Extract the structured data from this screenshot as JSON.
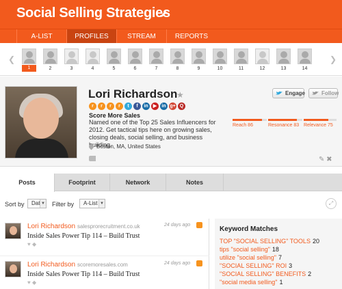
{
  "header": {
    "title": "Social Selling Strategies",
    "edit_icon": "pencil-icon"
  },
  "nav": {
    "tabs": [
      {
        "label": "A-LIST"
      },
      {
        "label": "PROFILES"
      },
      {
        "label": "STREAM"
      },
      {
        "label": "REPORTS"
      }
    ],
    "active": "PROFILES"
  },
  "strip": {
    "prev_icon": "chevron-left-icon",
    "next_icon": "chevron-right-icon",
    "active_index": 1,
    "thumbs": [
      {
        "num": "1",
        "has_photo": true
      },
      {
        "num": "2",
        "has_photo": true
      },
      {
        "num": "3",
        "has_photo": false
      },
      {
        "num": "4",
        "has_photo": false
      },
      {
        "num": "5",
        "has_photo": true
      },
      {
        "num": "6",
        "has_photo": true
      },
      {
        "num": "7",
        "has_photo": true
      },
      {
        "num": "8",
        "has_photo": true
      },
      {
        "num": "9",
        "has_photo": true
      },
      {
        "num": "10",
        "has_photo": true
      },
      {
        "num": "11",
        "has_photo": true
      },
      {
        "num": "12",
        "has_photo": false
      },
      {
        "num": "13",
        "has_photo": true
      },
      {
        "num": "14",
        "has_photo": true
      }
    ]
  },
  "profile": {
    "name": "Lori Richardson",
    "headline": "Score More Sales",
    "bio": "Named one of the Top 25 Sales Influencers for 2012. Get tactical tips here on growing sales, closing deals, social selling, and business building.",
    "location": "Boston, MA, United States",
    "engage_label": "Engage",
    "follow_label": "Follow",
    "social_icons": [
      {
        "name": "rss-icon",
        "glyph": "r",
        "color": "#f7931e"
      },
      {
        "name": "rss-icon",
        "glyph": "r",
        "color": "#f7931e"
      },
      {
        "name": "rss-icon",
        "glyph": "r",
        "color": "#f7931e"
      },
      {
        "name": "rss-icon",
        "glyph": "r",
        "color": "#f7931e"
      },
      {
        "name": "twitter-icon",
        "glyph": "t",
        "color": "#33aadd"
      },
      {
        "name": "facebook-icon",
        "glyph": "f",
        "color": "#3b5998"
      },
      {
        "name": "linkedin-icon",
        "glyph": "in",
        "color": "#1a6ea8"
      },
      {
        "name": "youtube-icon",
        "glyph": "▶",
        "color": "#cc2222"
      },
      {
        "name": "linkedin-icon",
        "glyph": "in",
        "color": "#1a6ea8"
      },
      {
        "name": "google-plus-icon",
        "glyph": "g+",
        "color": "#d34836"
      },
      {
        "name": "quora-icon",
        "glyph": "Q",
        "color": "#b92b27"
      }
    ],
    "metrics": [
      {
        "label": "Reach 86",
        "value": 86
      },
      {
        "label": "Resonance 83",
        "value": 83
      },
      {
        "label": "Relevance 75",
        "value": 75
      }
    ]
  },
  "tabs": {
    "items": [
      {
        "label": "Posts"
      },
      {
        "label": "Footprint"
      },
      {
        "label": "Network"
      },
      {
        "label": "Notes"
      }
    ],
    "active": "Posts"
  },
  "filters": {
    "sort_label": "Sort by",
    "sort_value": "Date",
    "filter_label": "Filter by",
    "filter_value": "A-List"
  },
  "posts": [
    {
      "author": "Lori Richardson",
      "source": "salesprorecruitment.co.uk",
      "time": "24 days ago",
      "title": "Inside Sales Power Tip 114 – Build Trust"
    },
    {
      "author": "Lori Richardson",
      "source": "scoremoresales.com",
      "time": "24 days ago",
      "title": "Inside Sales Power Tip 114 – Build Trust"
    }
  ],
  "keywords": {
    "title": "Keyword Matches",
    "items": [
      {
        "term": "TOP \"SOCIAL SELLING\" TOOLS",
        "count": "20"
      },
      {
        "term": "tips \"social selling\"",
        "count": "18"
      },
      {
        "term": "utilize \"social selling\"",
        "count": "7"
      },
      {
        "term": "\"SOCIAL SELLING\" ROI",
        "count": "3"
      },
      {
        "term": "\"SOCIAL SELLING\" BENEFITS",
        "count": "2"
      },
      {
        "term": "\"social media selling\"",
        "count": "1"
      }
    ]
  },
  "colors": {
    "brand": "#f25a1d"
  }
}
